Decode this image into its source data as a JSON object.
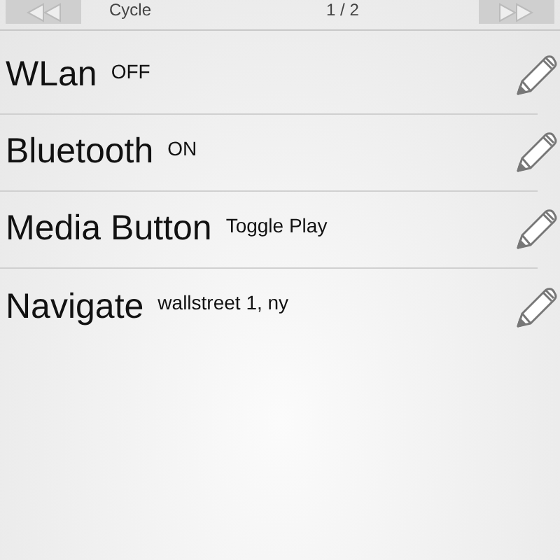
{
  "top_bar": {
    "title": "Cycle",
    "page": "1 / 2"
  },
  "items": [
    {
      "name": "WLan",
      "value": "OFF"
    },
    {
      "name": "Bluetooth",
      "value": "ON"
    },
    {
      "name": "Media Button",
      "value": "Toggle Play"
    },
    {
      "name": "Navigate",
      "value": "wallstreet 1, ny"
    }
  ]
}
